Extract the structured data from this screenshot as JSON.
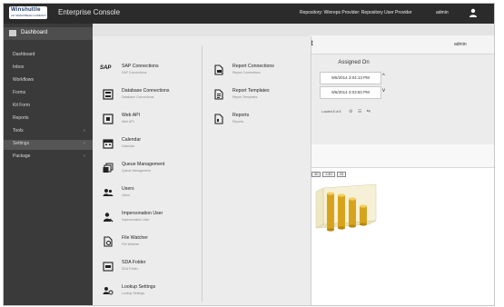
{
  "header": {
    "logo_text": "Winshuttle",
    "logo_sub": "AN SMARTBEAR COMPANY",
    "app_title": "Enterprise Console",
    "repository_label": "Repository: Winreps Provider: Repository User Provider",
    "user_name": "admin",
    "user_icon": "user-icon"
  },
  "sidebar": {
    "dashboard_label": "Dashboard",
    "items": [
      {
        "label": "Dashboard",
        "chevron": ""
      },
      {
        "label": "Inbox",
        "chevron": ""
      },
      {
        "label": "Workflows",
        "chevron": ""
      },
      {
        "label": "Forms",
        "chevron": ""
      },
      {
        "label": "Kit Form",
        "chevron": ""
      },
      {
        "label": "Reports",
        "chevron": ""
      },
      {
        "label": "Tools",
        "chevron": "›"
      },
      {
        "label": "Settings",
        "chevron": "›"
      },
      {
        "label": "Package",
        "chevron": "›"
      }
    ],
    "active_item": "Settings"
  },
  "mega_menu": {
    "left": [
      {
        "title": "SAP Connections",
        "sub": "SAP Connections",
        "icon": "sap-logo-icon"
      },
      {
        "title": "Database Connections",
        "sub": "Database Connections",
        "icon": "database-icon"
      },
      {
        "title": "Web API",
        "sub": "Web API",
        "icon": "web-api-icon"
      },
      {
        "title": "Calendar",
        "sub": "Calendar",
        "icon": "calendar-icon"
      },
      {
        "title": "Queue Management",
        "sub": "Queue Management",
        "icon": "queue-icon"
      },
      {
        "title": "Users",
        "sub": "Users",
        "icon": "users-icon"
      },
      {
        "title": "Impersonation User",
        "sub": "Impersonation User",
        "icon": "impersonation-icon"
      },
      {
        "title": "File Watcher",
        "sub": "File Watcher",
        "icon": "file-watcher-icon"
      },
      {
        "title": "SDA Folder",
        "sub": "SDA Folder",
        "icon": "folder-icon"
      },
      {
        "title": "Lookup Settings",
        "sub": "Lookup Settings",
        "icon": "lookup-icon"
      }
    ],
    "right": [
      {
        "title": "Report Connections",
        "sub": "Report Connections",
        "icon": "report-connections-icon"
      },
      {
        "title": "Report Templates",
        "sub": "Report Templates",
        "icon": "report-templates-icon"
      },
      {
        "title": "Reports",
        "sub": "Reports",
        "icon": "reports-icon"
      }
    ],
    "sap_text": "SAP"
  },
  "right_panel": {
    "admin_label": "admin",
    "head_mark": "t",
    "assigned_on_label": "Assigned On",
    "rows": [
      "9/6/2014 3:04:13 PM",
      "9/6/2014 3:03:50 PM"
    ],
    "arrow_up": "^",
    "arrow_down": "v",
    "pager_text": "Loaded 8 of 8",
    "pager_icons": "⚙ ☰ ⇆"
  },
  "chart_panel": {
    "tools": [
      "3D",
      "2.5D",
      "2D"
    ]
  }
}
